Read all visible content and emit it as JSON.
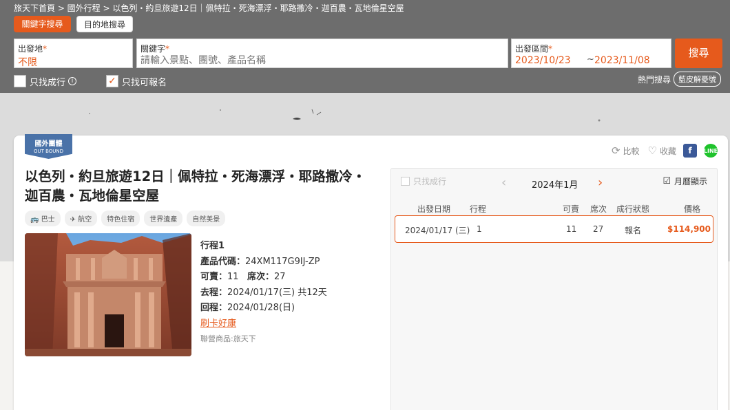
{
  "breadcrumb": "旅天下首頁 > 國外行程 > 以色列・約旦旅遊12日｜佩特拉・死海漂浮・耶路撒冷・迦百農・瓦地倫星空屋",
  "tabs": {
    "keyword": "關鍵字搜尋",
    "destination": "目的地搜尋"
  },
  "search": {
    "origin_label": "出發地",
    "origin_value": "不限",
    "keyword_label": "關鍵字",
    "keyword_placeholder": "請輸入景點、團號、產品名稱",
    "date_label": "出發區間",
    "date_from": "2023/10/23",
    "date_sep": "~",
    "date_to": "2023/11/08",
    "submit": "搜尋",
    "required_mark": "*"
  },
  "filters": {
    "only_departing": "只找成行",
    "only_available": "只找可報名",
    "only_available_checked": true
  },
  "hot_search": {
    "label": "熱門搜尋",
    "tag": "藍皮解憂號"
  },
  "card": {
    "ribbon_line1": "國外團體",
    "ribbon_line2": "OUT BOUND",
    "compare": "比較",
    "favorite": "收藏",
    "title": "以色列・約旦旅遊12日｜佩特拉・死海漂浮・耶路撒冷・迦百農・瓦地倫星空屋",
    "tags": [
      "巴士",
      "航空",
      "特色住宿",
      "世界遺產",
      "自然美景"
    ],
    "itinerary": "行程1",
    "code_label": "產品代碼：",
    "code": "24XM117G9IJ-ZP",
    "avail_label": "可賣：",
    "avail": "11",
    "seats_label": "席次：",
    "seats": "27",
    "go_label": "去程：",
    "go": "2024/01/17(三) 共12天",
    "back_label": "回程：",
    "back": "2024/01/28(日)",
    "promo": "刷卡好康",
    "operator": "聯營商品:旅天下"
  },
  "calendar": {
    "only_departing": "只找成行",
    "month": "2024年1月",
    "view_toggle": "月曆顯示",
    "headers": {
      "date": "出發日期",
      "trip": "行程",
      "avail": "可賣",
      "seats": "席次",
      "status": "成行狀態",
      "price": "價格"
    },
    "rows": [
      {
        "date": "2024/01/17 (三)",
        "trip": "1",
        "avail": "11",
        "seats": "27",
        "status": "報名",
        "price": "$114,900"
      }
    ]
  },
  "colors": {
    "accent": "#e65a1c",
    "header_bg": "#6d6d6d",
    "ribbon": "#4a72a8"
  },
  "icons": [
    "info-icon",
    "bus-icon",
    "plane-icon",
    "compare-icon",
    "heart-icon",
    "facebook-icon",
    "line-icon",
    "calendar-icon",
    "chevron-left-icon",
    "chevron-right-icon",
    "check-icon"
  ]
}
